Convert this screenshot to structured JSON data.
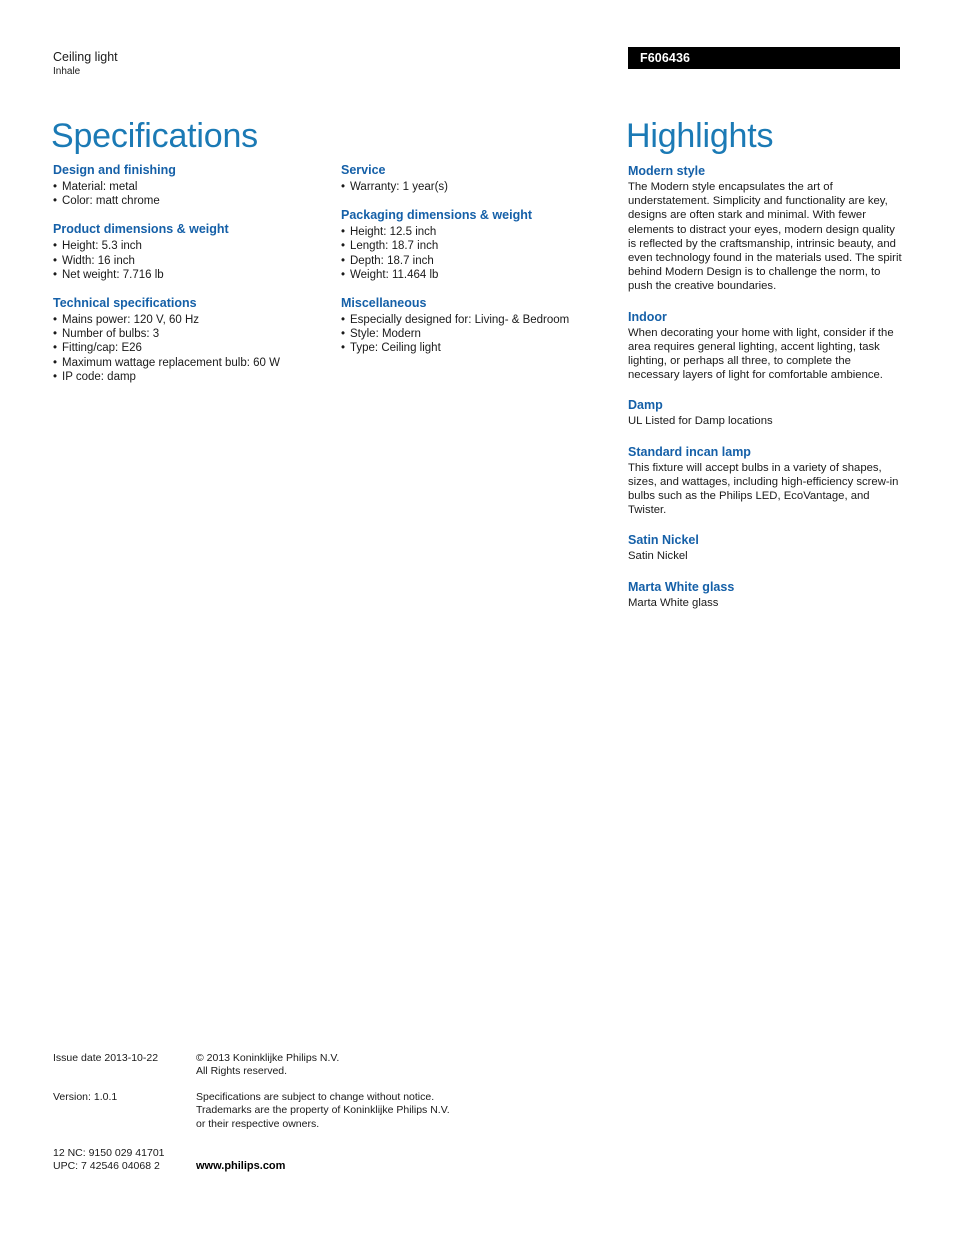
{
  "header": {
    "product_type": "Ceiling light",
    "product_name": "Inhale",
    "model_number": "F606436",
    "specifications_title": "Specifications",
    "highlights_title": "Highlights"
  },
  "colors": {
    "title_blue": "#1b7ab5",
    "heading_blue": "#1560a8",
    "model_bar_bg": "#000000",
    "model_bar_text": "#ffffff",
    "body_text": "#1a1a1a"
  },
  "specifications": {
    "column_1": [
      {
        "heading": "Design and finishing",
        "items": [
          "Material: metal",
          "Color: matt chrome"
        ]
      },
      {
        "heading": "Product dimensions & weight",
        "items": [
          "Height: 5.3 inch",
          "Width: 16 inch",
          "Net weight: 7.716 lb"
        ]
      },
      {
        "heading": "Technical specifications",
        "items": [
          "Mains power: 120 V, 60 Hz",
          "Number of bulbs: 3",
          "Fitting/cap: E26",
          "Maximum wattage replacement bulb: 60 W",
          "IP code: damp"
        ]
      }
    ],
    "column_2": [
      {
        "heading": "Service",
        "items": [
          "Warranty: 1 year(s)"
        ]
      },
      {
        "heading": "Packaging dimensions & weight",
        "items": [
          "Height: 12.5 inch",
          "Length: 18.7 inch",
          "Depth: 18.7 inch",
          "Weight: 11.464 lb"
        ]
      },
      {
        "heading": "Miscellaneous",
        "items": [
          "Especially designed for: Living- & Bedroom",
          "Style: Modern",
          "Type: Ceiling light"
        ]
      }
    ]
  },
  "highlights": [
    {
      "heading": "Modern style",
      "body": "The Modern style encapsulates the art of understatement. Simplicity and functionality are key, designs are often stark and minimal. With fewer elements to distract your eyes, modern design quality is reflected by the craftsmanship, intrinsic beauty, and even technology found in the materials used. The spirit behind Modern Design is to challenge the norm, to push the creative boundaries."
    },
    {
      "heading": "Indoor",
      "body": "When decorating your home with light, consider if the area requires general lighting, accent lighting, task lighting, or perhaps all three, to complete the necessary layers of light for comfortable ambience."
    },
    {
      "heading": "Damp",
      "body": "UL Listed for Damp locations"
    },
    {
      "heading": "Standard incan lamp",
      "body": "This fixture will accept bulbs in a variety of shapes, sizes, and wattages, including high-efficiency screw-in bulbs such as the Philips LED, EcoVantage, and Twister."
    },
    {
      "heading": "Satin Nickel",
      "body": "Satin Nickel"
    },
    {
      "heading": "Marta White glass",
      "body": "Marta White glass"
    }
  ],
  "footer": {
    "issue_date": "Issue date 2013-10-22",
    "copyright_line_1": "© 2013 Koninklijke Philips N.V.",
    "copyright_line_2": "All Rights reserved.",
    "version": "Version: 1.0.1",
    "disclaimer_line_1": "Specifications are subject to change without notice.",
    "disclaimer_line_2": "Trademarks are the property of Koninklijke Philips N.V.",
    "disclaimer_line_3": "or their respective owners.",
    "nc_code": "12 NC: 9150 029 41701",
    "upc_code": "UPC: 7 42546 04068 2",
    "website": "www.philips.com"
  }
}
